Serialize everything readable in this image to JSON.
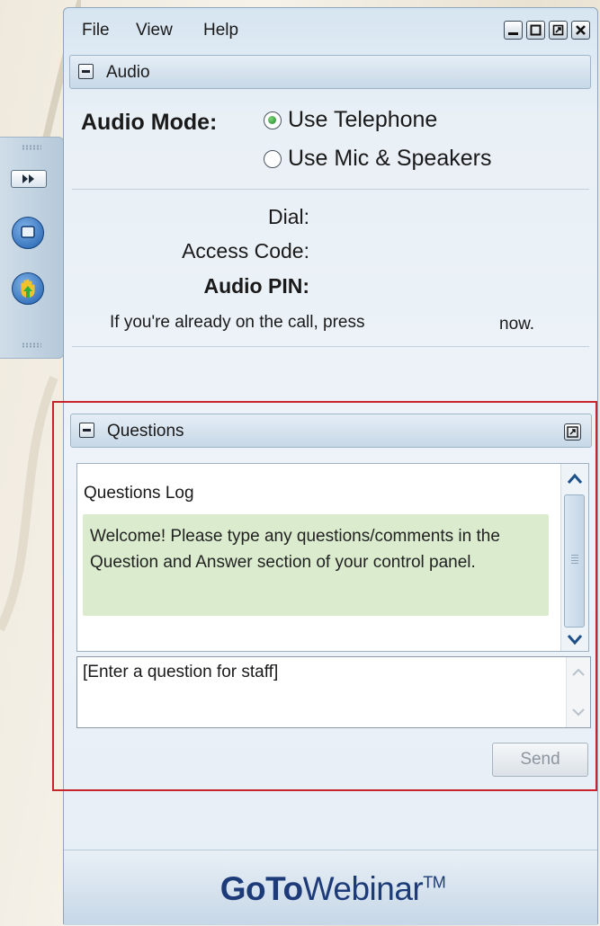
{
  "menu": {
    "file": "File",
    "view": "View",
    "help": "Help"
  },
  "window_controls": [
    "minimize-icon",
    "maximize-icon",
    "popout-icon",
    "close-icon"
  ],
  "audio": {
    "title": "Audio",
    "mode_label": "Audio Mode:",
    "options": [
      {
        "label": "Use Telephone",
        "selected": true
      },
      {
        "label": "Use Mic & Speakers",
        "selected": false
      }
    ],
    "dial_label": "Dial:",
    "access_code_label": "Access Code:",
    "pin_label": "Audio PIN:",
    "note_prefix": "If you're already on the call, press",
    "note_suffix": "now."
  },
  "questions": {
    "title": "Questions",
    "log_title": "Questions Log",
    "welcome": "Welcome! Please type any questions/comments in the Question and Answer section of your control panel.",
    "input_placeholder": "[Enter a question for staff]",
    "send_label": "Send"
  },
  "brand": {
    "part1": "GoTo",
    "part2": "Webinar",
    "tm": "TM"
  },
  "colors": {
    "highlight_border": "#c8242b",
    "welcome_bg": "#dbecce",
    "brand": "#1d3b78"
  }
}
